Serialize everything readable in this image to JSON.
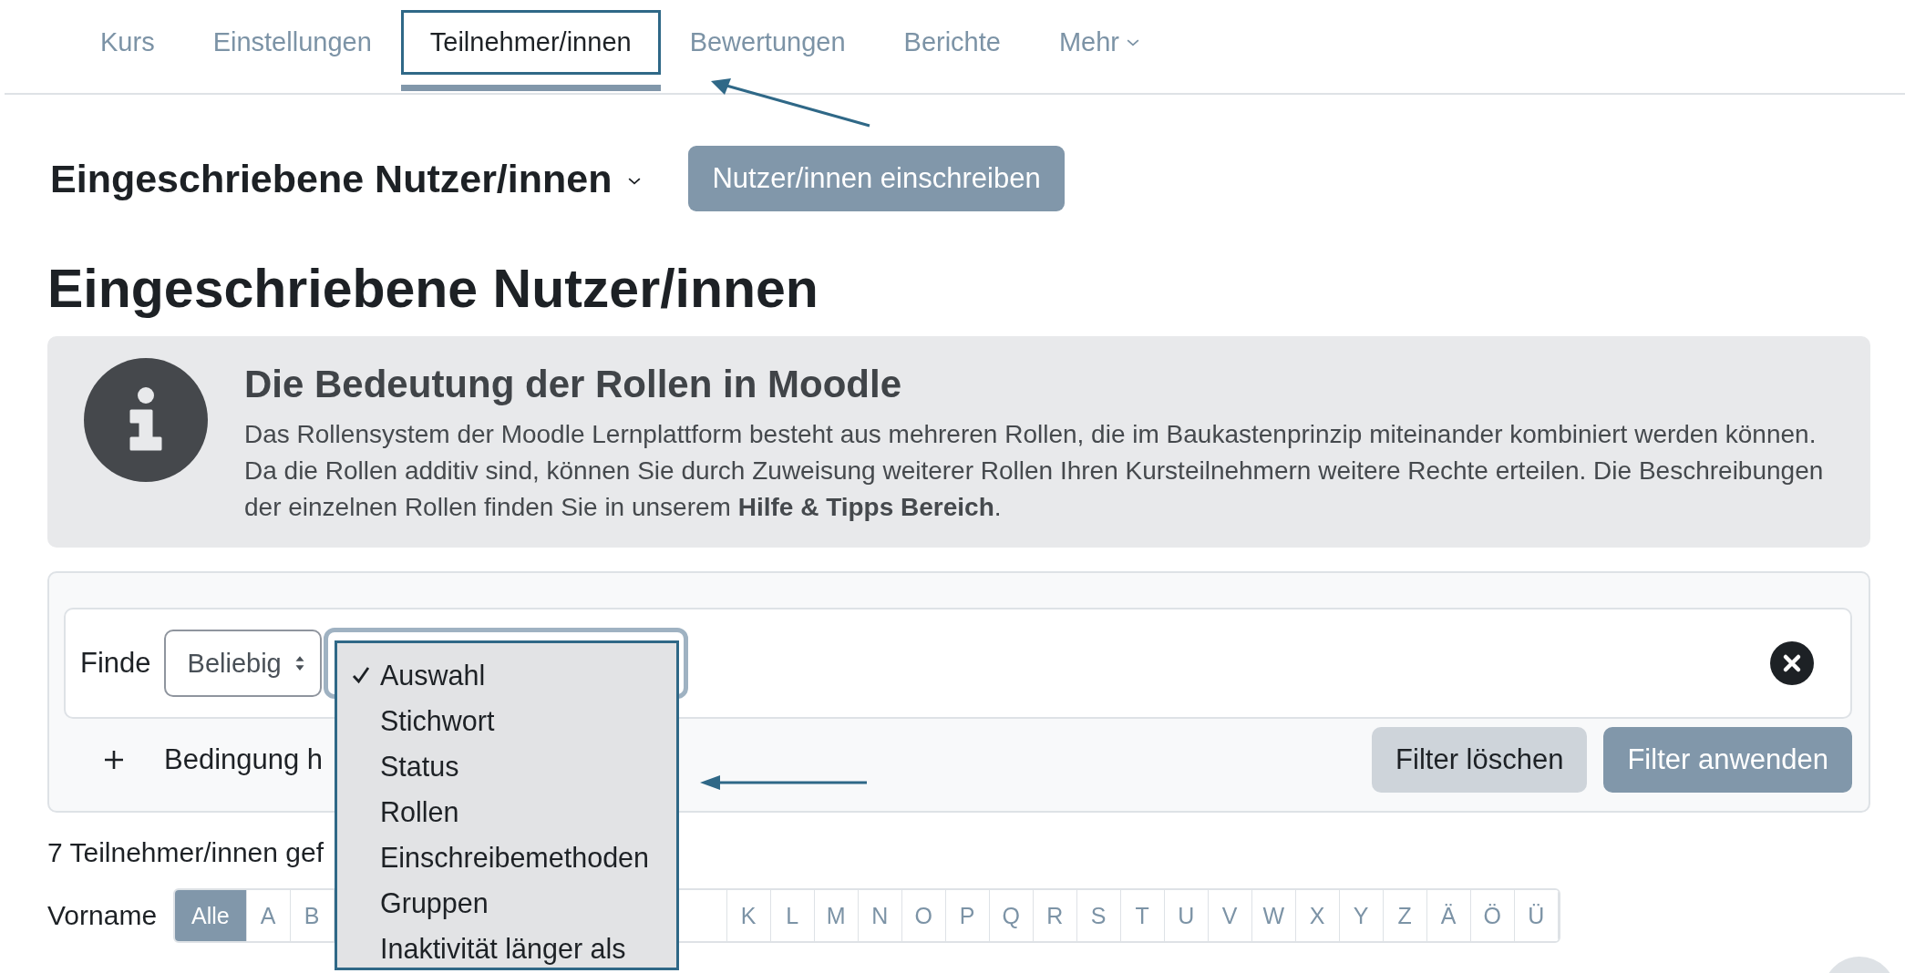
{
  "tabs": [
    {
      "label": "Kurs",
      "selected": false,
      "highlighted": false,
      "has_menu": false
    },
    {
      "label": "Einstellungen",
      "selected": false,
      "highlighted": false,
      "has_menu": false
    },
    {
      "label": "Teilnehmer/innen",
      "selected": true,
      "highlighted": true,
      "has_menu": false
    },
    {
      "label": "Bewertungen",
      "selected": false,
      "highlighted": false,
      "has_menu": false
    },
    {
      "label": "Berichte",
      "selected": false,
      "highlighted": false,
      "has_menu": false
    },
    {
      "label": "Mehr",
      "selected": false,
      "highlighted": false,
      "has_menu": true
    }
  ],
  "page_menu": {
    "title": "Eingeschriebene Nutzer/innen",
    "button": "Nutzer/innen einschreiben"
  },
  "heading": "Eingeschriebene Nutzer/innen",
  "notice": {
    "title": "Die Bedeutung der Rollen in Moodle",
    "text": "Das Rollensystem der Moodle Lernplattform besteht aus mehreren Rollen, die im Baukastenprinzip miteinander kombiniert werden können. Da die Rollen additiv sind, können Sie durch Zuweisung weiterer Rollen Ihren Kursteilnehmern weitere Rechte erteilen. Die Beschreibungen der einzelnen Rollen finden Sie in unserem **Hilfe & Tipps Bereich**."
  },
  "filter": {
    "match_label": "Finde",
    "match_value": "Beliebig",
    "add_label": "Bedingung h",
    "condition_menu": [
      {
        "label": "Auswahl",
        "selected": true
      },
      {
        "label": "Stichwort",
        "selected": false
      },
      {
        "label": "Status",
        "selected": false
      },
      {
        "label": "Rollen",
        "selected": false
      },
      {
        "label": "Einschreibemethoden",
        "selected": false
      },
      {
        "label": "Gruppen",
        "selected": false
      },
      {
        "label": "Inaktivität länger als",
        "selected": false
      }
    ],
    "buttons": [
      {
        "label": "Filter löschen",
        "kind": "secondary"
      },
      {
        "label": "Filter anwenden",
        "kind": "primary"
      }
    ]
  },
  "count": "7 Teilnehmer/innen gef",
  "initials": {
    "label": "Vorname",
    "letters_before": [
      {
        "label": "Alle",
        "selected": true
      },
      {
        "label": "A",
        "selected": false
      },
      {
        "label": "B",
        "selected": false
      }
    ],
    "letters_after": [
      {
        "label": "K",
        "selected": false
      },
      {
        "label": "L",
        "selected": false
      },
      {
        "label": "M",
        "selected": false
      },
      {
        "label": "N",
        "selected": false
      },
      {
        "label": "O",
        "selected": false
      },
      {
        "label": "P",
        "selected": false
      },
      {
        "label": "Q",
        "selected": false
      },
      {
        "label": "R",
        "selected": false
      },
      {
        "label": "S",
        "selected": false
      },
      {
        "label": "T",
        "selected": false
      },
      {
        "label": "U",
        "selected": false
      },
      {
        "label": "V",
        "selected": false
      },
      {
        "label": "W",
        "selected": false
      },
      {
        "label": "X",
        "selected": false
      },
      {
        "label": "Y",
        "selected": false
      },
      {
        "label": "Z",
        "selected": false
      },
      {
        "label": "Ä",
        "selected": false
      },
      {
        "label": "Ö",
        "selected": false
      },
      {
        "label": "Ü",
        "selected": false
      }
    ]
  }
}
